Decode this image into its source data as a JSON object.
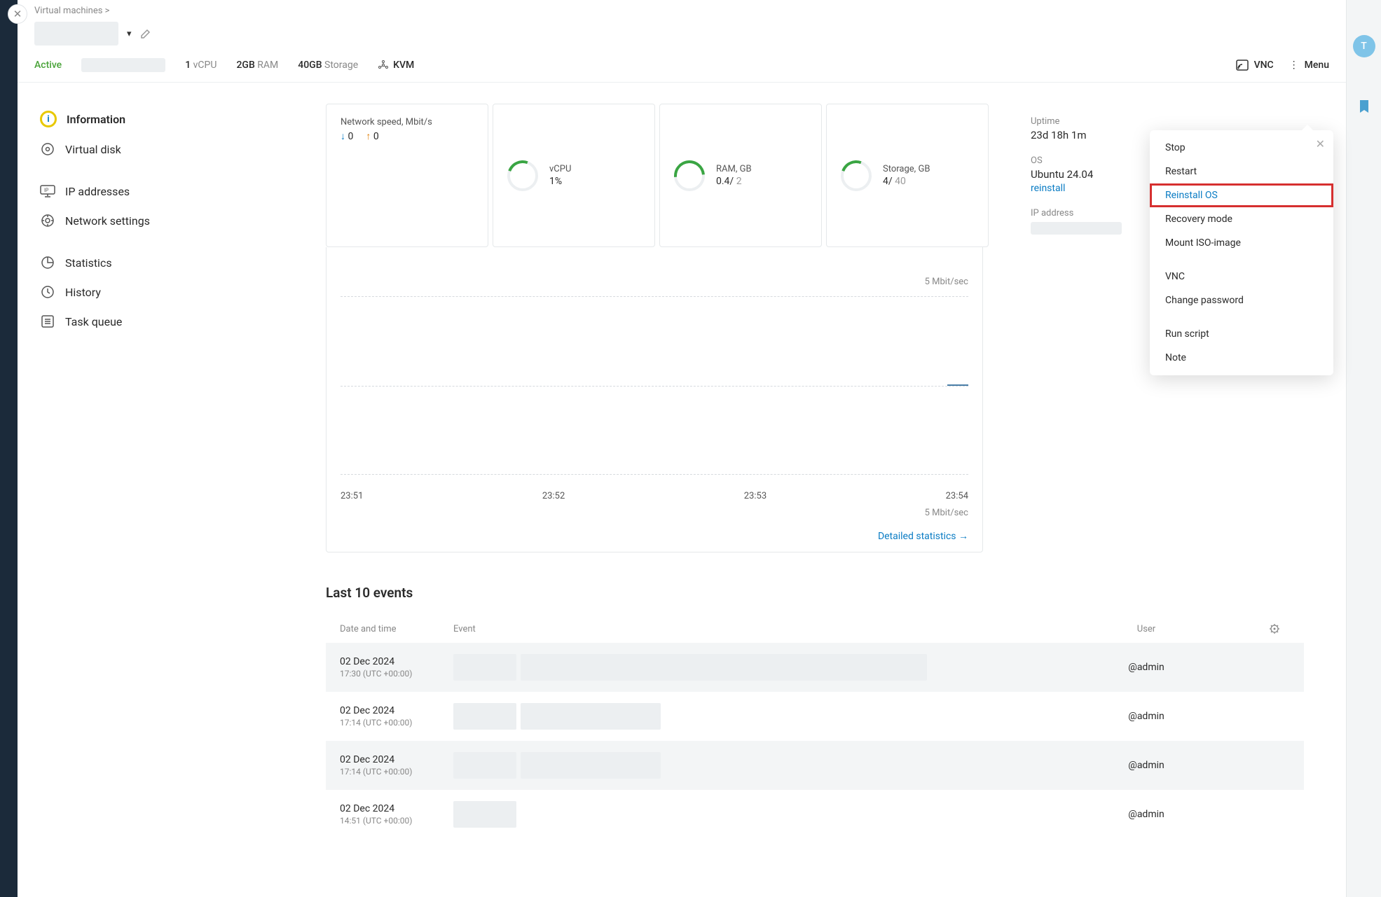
{
  "breadcrumb": {
    "parent": "Virtual machines",
    "sep": ">"
  },
  "status": {
    "label": "Active"
  },
  "specs": {
    "vcpu_n": "1",
    "vcpu_unit": "vCPU",
    "ram_n": "2GB",
    "ram_unit": "RAM",
    "storage_n": "40GB",
    "storage_unit": "Storage",
    "kvm": "KVM"
  },
  "topright": {
    "vnc": "VNC",
    "menu": "Menu"
  },
  "sidenav": {
    "information": "Information",
    "virtual_disk": "Virtual disk",
    "ip_addresses": "IP addresses",
    "network_settings": "Network settings",
    "statistics": "Statistics",
    "history": "History",
    "task_queue": "Task queue"
  },
  "gauges": {
    "netspeed_label": "Network speed, Mbit/s",
    "netspeed_down": "0",
    "netspeed_up": "0",
    "vcpu_label": "vCPU",
    "vcpu_val": "1%",
    "ram_label": "RAM, GB",
    "ram_val": "0.4/",
    "ram_max": " 2",
    "storage_label": "Storage, GB",
    "storage_val": "4/",
    "storage_max": " 40"
  },
  "meta": {
    "uptime_label": "Uptime",
    "uptime": "23d 18h 1m",
    "os_label": "OS",
    "os": "Ubuntu 24.04",
    "reinstall": "reinstall",
    "ip_label": "IP address"
  },
  "chart": {
    "y_unit_top": "5 Mbit/sec",
    "y_unit_bottom": "5 Mbit/sec",
    "x_ticks": [
      "23:51",
      "23:52",
      "23:53",
      "23:54"
    ],
    "detailed": "Detailed statistics →"
  },
  "chart_data": {
    "type": "line",
    "title": "Network speed",
    "ylabel": "Mbit/sec",
    "ylim": [
      -5,
      5
    ],
    "x": [
      "23:51",
      "23:52",
      "23:53",
      "23:54"
    ],
    "series": [
      {
        "name": "download",
        "values": [
          0,
          0,
          0,
          0
        ]
      },
      {
        "name": "upload",
        "values": [
          0,
          0,
          0,
          0
        ]
      }
    ]
  },
  "events": {
    "title": "Last 10 events",
    "head_date": "Date and time",
    "head_event": "Event",
    "head_user": "User",
    "rows": [
      {
        "date": "02 Dec 2024",
        "time": "17:30 (UTC +00:00)",
        "user": "@admin"
      },
      {
        "date": "02 Dec 2024",
        "time": "17:14 (UTC +00:00)",
        "user": "@admin"
      },
      {
        "date": "02 Dec 2024",
        "time": "17:14 (UTC +00:00)",
        "user": "@admin"
      },
      {
        "date": "02 Dec 2024",
        "time": "14:51 (UTC +00:00)",
        "user": "@admin"
      }
    ]
  },
  "dropdown": {
    "stop": "Stop",
    "restart": "Restart",
    "reinstall_os": "Reinstall OS",
    "recovery": "Recovery mode",
    "mount_iso": "Mount ISO-image",
    "vnc": "VNC",
    "change_password": "Change password",
    "run_script": "Run script",
    "note": "Note"
  },
  "avatar": "T"
}
